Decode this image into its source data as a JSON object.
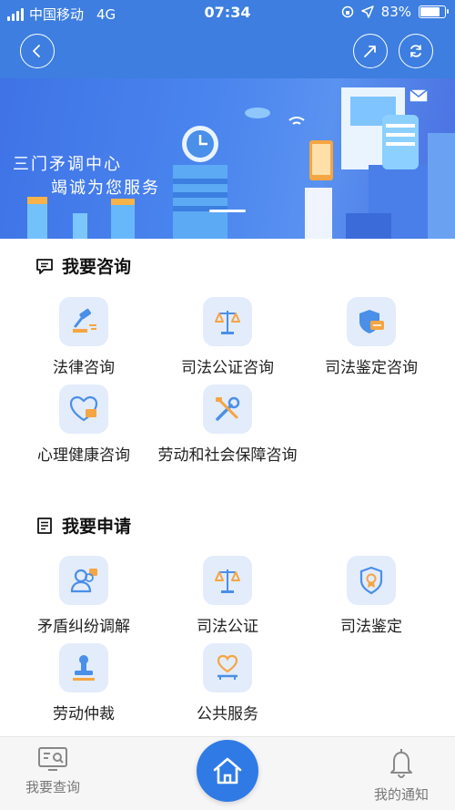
{
  "status_bar": {
    "carrier": "中国移动",
    "network": "4G",
    "time": "07:34",
    "battery": "83%",
    "battery_level": 0.83
  },
  "nav": {
    "back_icon": "chevron-left-icon",
    "share_icon": "share-icon",
    "refresh_icon": "refresh-icon"
  },
  "banner": {
    "title": "三门矛调中心",
    "subtitle": "竭诚为您服务"
  },
  "consult": {
    "title": "我要咨询",
    "items": [
      {
        "label": "法律咨询",
        "icon": "gavel-icon"
      },
      {
        "label": "司法公证咨询",
        "icon": "scales-icon"
      },
      {
        "label": "司法鉴定咨询",
        "icon": "shield-card-icon"
      },
      {
        "label": "心理健康咨询",
        "icon": "heart-icon"
      },
      {
        "label": "劳动和社会保障咨询",
        "icon": "tools-icon"
      }
    ]
  },
  "apply": {
    "title": "我要申请",
    "items": [
      {
        "label": "矛盾纠纷调解",
        "icon": "users-icon"
      },
      {
        "label": "司法公证",
        "icon": "scales-icon"
      },
      {
        "label": "司法鉴定",
        "icon": "badge-shield-icon"
      },
      {
        "label": "劳动仲裁",
        "icon": "stamp-icon"
      },
      {
        "label": "公共服务",
        "icon": "heart-hand-icon"
      }
    ]
  },
  "bottom_nav": {
    "query_label": "我要查询",
    "notify_label": "我的通知"
  },
  "colors": {
    "primary": "#3d7ee0",
    "icon_bg": "#e3ecfb",
    "accent_orange": "#f5a542"
  }
}
